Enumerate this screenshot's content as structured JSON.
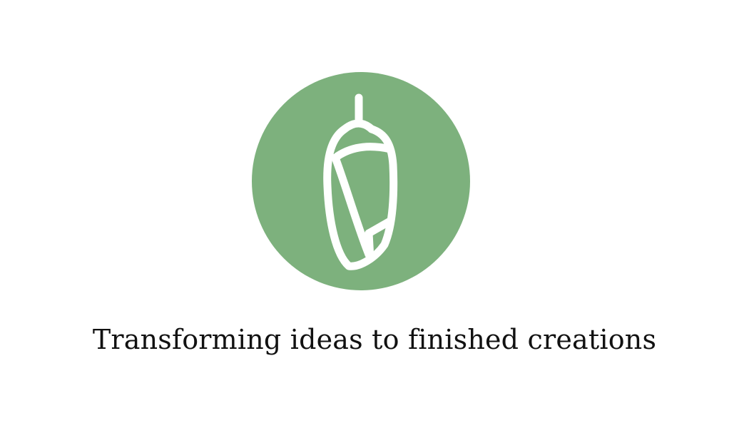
{
  "brand": {
    "tagline": "Transforming ideas to finished creations",
    "emblem_icon": "chrysalis-icon",
    "colors": {
      "emblem_fill": "#7db17d",
      "icon_stroke": "#ffffff",
      "text": "#111111",
      "background": "#ffffff"
    }
  }
}
